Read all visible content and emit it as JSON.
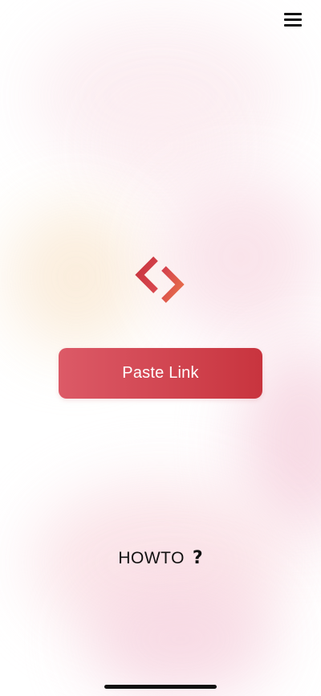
{
  "header": {
    "menu_icon": "hamburger-menu-icon"
  },
  "logo": {
    "icon": "angle-brackets-logo",
    "colors": [
      "#c8343e",
      "#e26c4a"
    ]
  },
  "main": {
    "paste_label": "Paste Link"
  },
  "footer": {
    "howto_label": "HOWTO",
    "howto_icon_glyph": "?"
  },
  "colors": {
    "accent_start": "#dc5a67",
    "accent_end": "#c8343e"
  }
}
